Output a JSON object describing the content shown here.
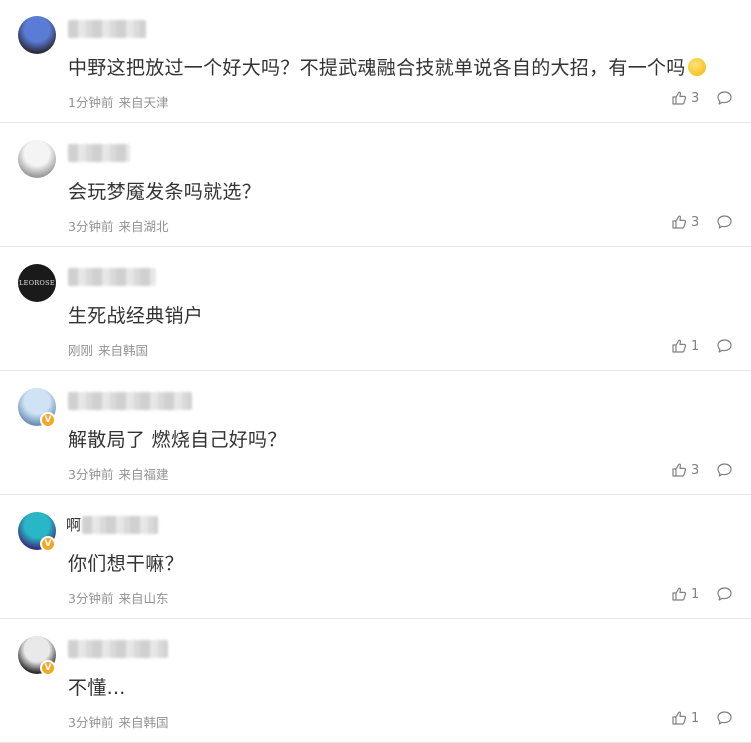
{
  "comments": [
    {
      "name_prefix": "",
      "text": "中野这把放过一个好大吗？不提武魂融合技就单说各自的大招，有一个吗",
      "has_emoji": true,
      "time": "1分钟前",
      "location": "来自天津",
      "likes": "3",
      "verified": false,
      "avatar_colors": [
        "#5a7bd6",
        "#2b2b3a"
      ]
    },
    {
      "name_prefix": "",
      "text": "会玩梦魇发条吗就选？",
      "has_emoji": false,
      "time": "3分钟前",
      "location": "来自湖北",
      "likes": "3",
      "verified": false,
      "avatar_colors": [
        "#f4f4f4",
        "#9a9a9a"
      ]
    },
    {
      "name_prefix": "",
      "text": "生死战经典销户",
      "has_emoji": false,
      "time": "刚刚",
      "location": "来自韩国",
      "likes": "1",
      "verified": false,
      "avatar_text": "LEOROSE",
      "avatar_colors": [
        "#1a1a1a",
        "#e03a3a"
      ]
    },
    {
      "name_prefix": "",
      "text": "解散局了 燃烧自己好吗？",
      "has_emoji": false,
      "time": "3分钟前",
      "location": "来自福建",
      "likes": "3",
      "verified": true,
      "avatar_colors": [
        "#cfe3f5",
        "#6b8fb5"
      ]
    },
    {
      "name_prefix": "啊",
      "text": "你们想干嘛？",
      "has_emoji": false,
      "time": "3分钟前",
      "location": "来自山东",
      "likes": "1",
      "verified": true,
      "avatar_colors": [
        "#29b6c6",
        "#3a2f7a"
      ]
    },
    {
      "name_prefix": "",
      "text": "不懂...",
      "has_emoji": false,
      "time": "3分钟前",
      "location": "来自韩国",
      "likes": "1",
      "verified": true,
      "avatar_colors": [
        "#e9e9e9",
        "#2a2a2a"
      ]
    }
  ],
  "icons": {
    "like": "thumbs-up-icon",
    "reply": "comment-bubble-icon",
    "verified": "verified-badge-icon"
  },
  "verified_mark": "V"
}
